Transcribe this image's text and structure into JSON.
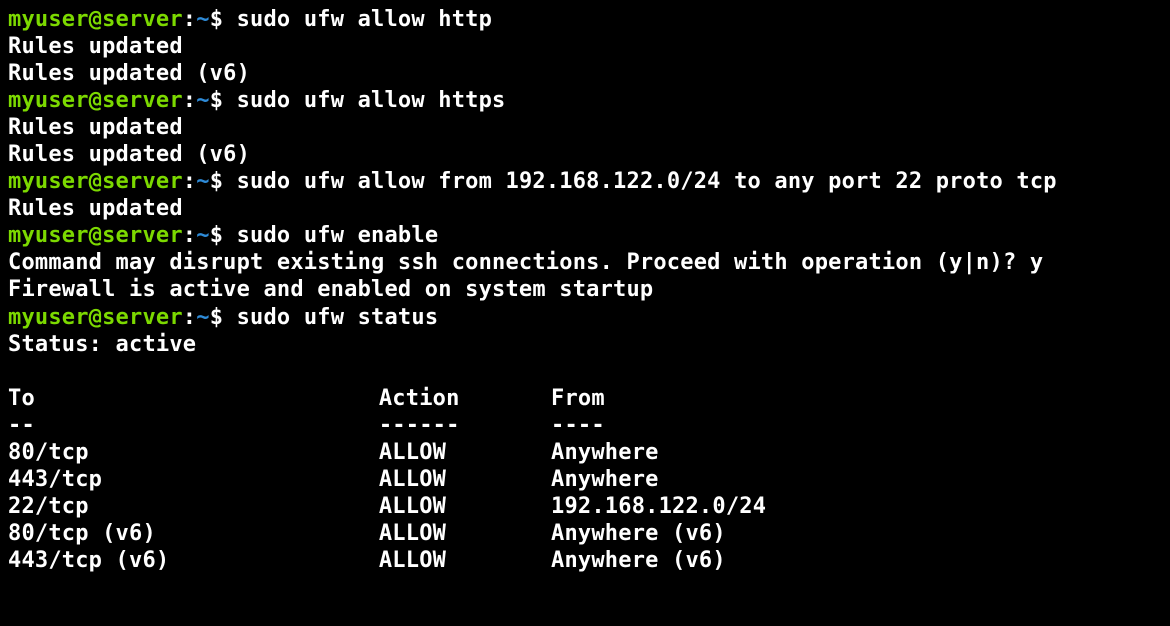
{
  "prompt": {
    "user_host": "myuser@server",
    "colon": ":",
    "path": "~",
    "sigil": "$ "
  },
  "lines": [
    {
      "type": "prompt",
      "cmd": "sudo ufw allow http"
    },
    {
      "type": "out",
      "text": "Rules updated"
    },
    {
      "type": "out",
      "text": "Rules updated (v6)"
    },
    {
      "type": "prompt",
      "cmd": "sudo ufw allow https"
    },
    {
      "type": "out",
      "text": "Rules updated"
    },
    {
      "type": "out",
      "text": "Rules updated (v6)"
    },
    {
      "type": "prompt",
      "cmd": "sudo ufw allow from 192.168.122.0/24 to any port 22 proto tcp"
    },
    {
      "type": "out",
      "text": "Rules updated"
    },
    {
      "type": "prompt",
      "cmd": "sudo ufw enable"
    },
    {
      "type": "out",
      "text": "Command may disrupt existing ssh connections. Proceed with operation (y|n)? y"
    },
    {
      "type": "out",
      "text": "Firewall is active and enabled on system startup"
    },
    {
      "type": "prompt",
      "cmd": "sudo ufw status"
    },
    {
      "type": "out",
      "text": "Status: active"
    },
    {
      "type": "out",
      "text": ""
    }
  ],
  "table": {
    "headers": {
      "to": "To",
      "action": "Action",
      "from": "From"
    },
    "separators": {
      "to": "--",
      "action": "------",
      "from": "----"
    },
    "rows": [
      {
        "to": "80/tcp",
        "action": "ALLOW",
        "from": "Anywhere"
      },
      {
        "to": "443/tcp",
        "action": "ALLOW",
        "from": "Anywhere"
      },
      {
        "to": "22/tcp",
        "action": "ALLOW",
        "from": "192.168.122.0/24"
      },
      {
        "to": "80/tcp (v6)",
        "action": "ALLOW",
        "from": "Anywhere (v6)"
      },
      {
        "to": "443/tcp (v6)",
        "action": "ALLOW",
        "from": "Anywhere (v6)"
      }
    ]
  }
}
